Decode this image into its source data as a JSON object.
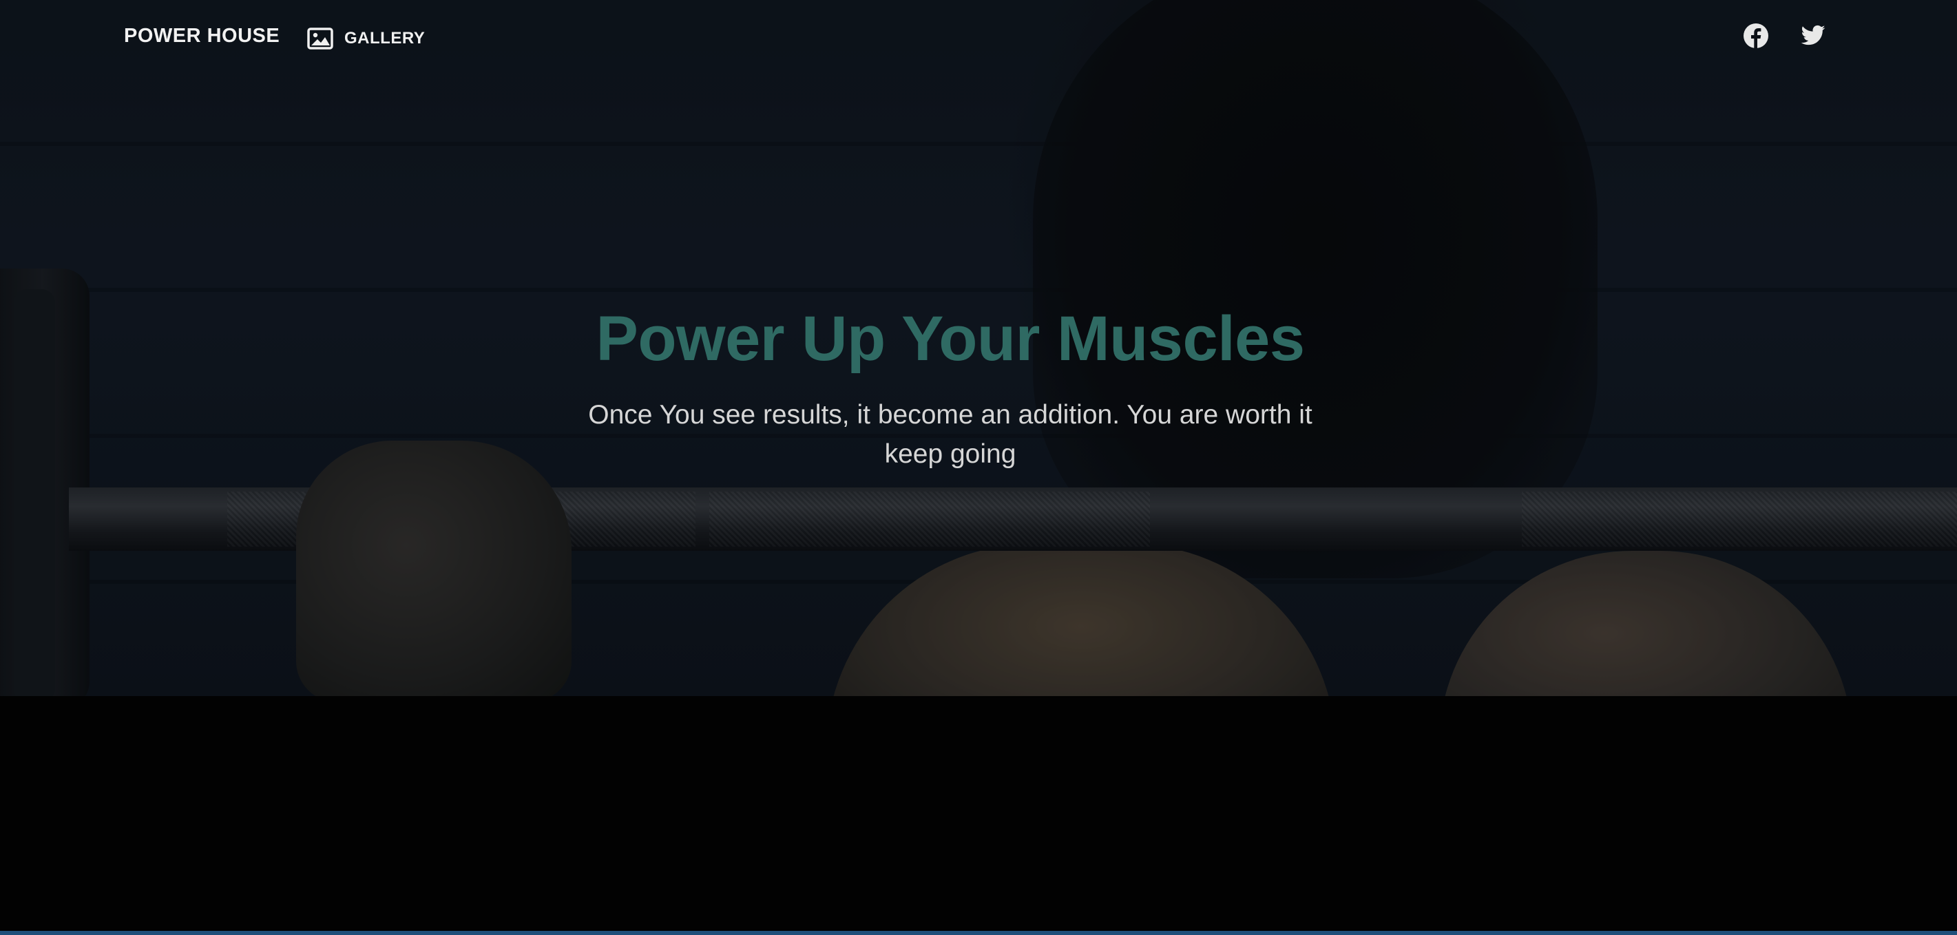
{
  "nav": {
    "brand": "POWER HOUSE",
    "gallery_label": "GALLERY",
    "gallery_icon": "image-icon",
    "social": [
      {
        "name": "facebook-icon"
      },
      {
        "name": "twitter-icon"
      }
    ]
  },
  "hero": {
    "headline": "Power Up Your Muscles",
    "tagline": "Once You see results, it become an addition. You are worth it keep going"
  },
  "colors": {
    "headline": "#2f6a63",
    "nav_text": "#f2f2f2",
    "background": "#020202"
  }
}
